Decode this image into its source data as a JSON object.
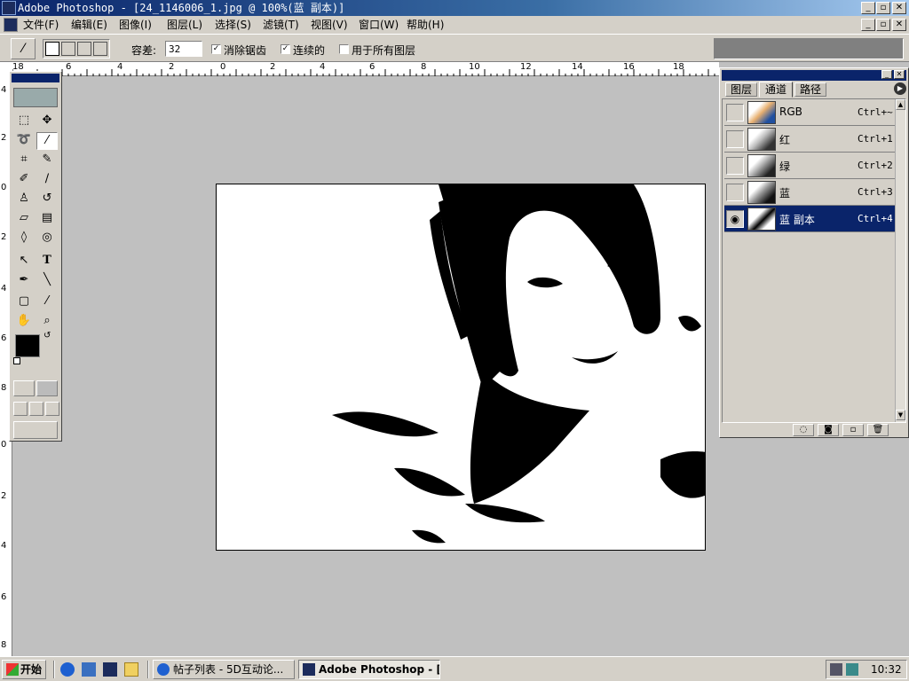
{
  "window": {
    "title": "Adobe Photoshop - [24_1146006_1.jpg @ 100%(蓝 副本)]",
    "minimize": "_",
    "restore": "▫",
    "close": "✕"
  },
  "menu": [
    "文件(F)",
    "编辑(E)",
    "图像(I)",
    "图层(L)",
    "选择(S)",
    "滤镜(T)",
    "视图(V)",
    "窗口(W)",
    "帮助(H)"
  ],
  "options": {
    "tolerance_label": "容差:",
    "tolerance_value": "32",
    "antialias_label": "消除锯齿",
    "antialias_checked": true,
    "contiguous_label": "连续的",
    "contiguous_checked": true,
    "all_layers_label": "用于所有图层",
    "all_layers_checked": false
  },
  "ruler": {
    "h_labels": [
      "18",
      "6",
      "4",
      "2",
      "0",
      "2",
      "4",
      "6",
      "8",
      "10",
      "12",
      "14",
      "16",
      "18"
    ],
    "v_labels": [
      "4",
      "2",
      "0",
      "2",
      "4",
      "6",
      "8",
      "0",
      "2",
      "4",
      "6",
      "8"
    ]
  },
  "palette": {
    "tabs": [
      "图层",
      "通道",
      "路径"
    ],
    "active_tab": "通道",
    "channels": [
      {
        "name": "RGB",
        "shortcut": "Ctrl+~",
        "visible": false,
        "active": false
      },
      {
        "name": "红",
        "shortcut": "Ctrl+1",
        "visible": false,
        "active": false
      },
      {
        "name": "绿",
        "shortcut": "Ctrl+2",
        "visible": false,
        "active": false
      },
      {
        "name": "蓝",
        "shortcut": "Ctrl+3",
        "visible": false,
        "active": false
      },
      {
        "name": "蓝 副本",
        "shortcut": "Ctrl+4",
        "visible": true,
        "active": true
      }
    ]
  },
  "taskbar": {
    "start": "开始",
    "task1": "帖子列表 - 5D互动论...",
    "task2": "Adobe Photoshop - [...",
    "clock": "10:32"
  }
}
